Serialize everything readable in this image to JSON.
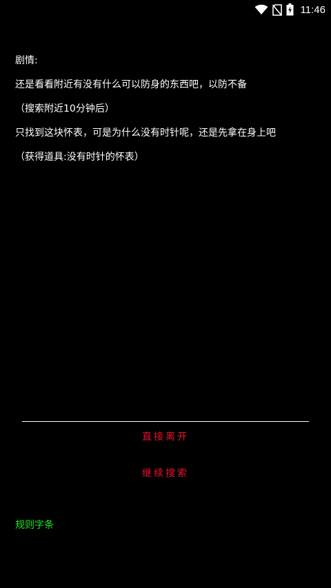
{
  "status_bar": {
    "time": "11:46",
    "icons": [
      "wifi-icon",
      "no-sim-icon",
      "battery-charging-icon"
    ]
  },
  "story": {
    "lines": [
      "剧情:",
      "还是看看附近有没有什么可以防身的东西吧，以防不备",
      "（搜索附近10分钟后）",
      "只找到这块怀表，可是为什么没有时针呢，还是先拿在身上吧",
      "（获得道具:没有时针的怀表）"
    ]
  },
  "choices": [
    {
      "label": "直接离开"
    },
    {
      "label": "继续搜索"
    }
  ],
  "rules_link": {
    "label": "规则字条"
  },
  "colors": {
    "background": "#000000",
    "text": "#ffffff",
    "choice": "#e8132b",
    "link": "#22e522",
    "divider": "#ffffff"
  }
}
